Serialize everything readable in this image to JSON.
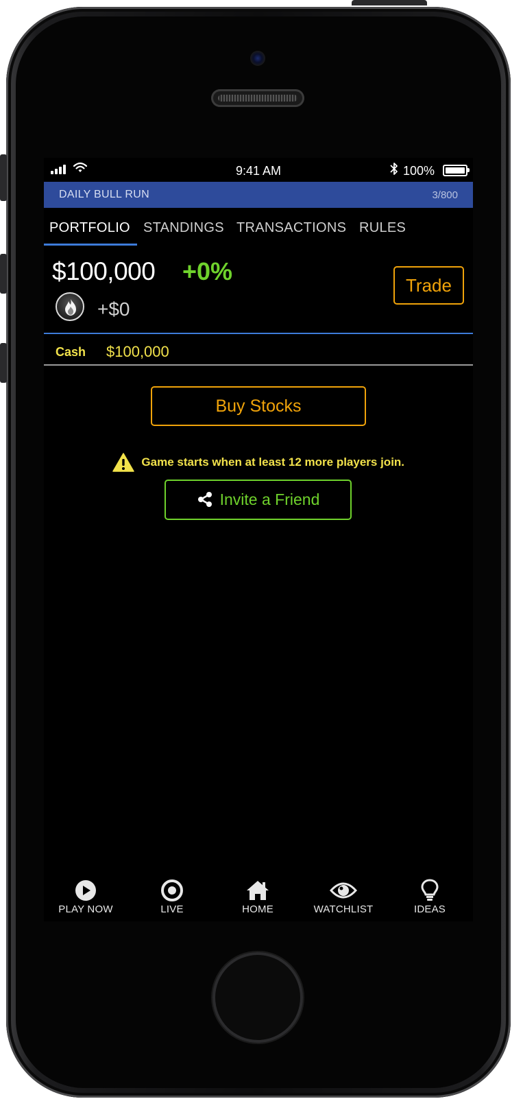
{
  "status_bar": {
    "time": "9:41 AM",
    "battery": "100%",
    "icons": [
      "signal-icon",
      "wifi-icon",
      "bluetooth-icon",
      "battery-icon"
    ]
  },
  "game": {
    "title": "DAILY BULL RUN",
    "count": "3/800"
  },
  "tabs": [
    {
      "label": "PORTFOLIO",
      "active": true
    },
    {
      "label": "STANDINGS",
      "active": false
    },
    {
      "label": "TRANSACTIONS",
      "active": false
    },
    {
      "label": "RULES",
      "active": false
    }
  ],
  "portfolio": {
    "balance": "$100,000",
    "change_pct": "+0%",
    "gain": "+$0",
    "badge_icon": "fire-icon",
    "trade_label": "Trade",
    "cash_label": "Cash",
    "cash_value": "$100,000"
  },
  "actions": {
    "buy_label": "Buy Stocks",
    "warning": "Game starts when at least 12 more players join.",
    "invite_label": "Invite a Friend"
  },
  "bottom_nav": [
    {
      "label": "PLAY NOW",
      "icon": "play-icon"
    },
    {
      "label": "LIVE",
      "icon": "live-icon"
    },
    {
      "label": "HOME",
      "icon": "home-icon"
    },
    {
      "label": "WATCHLIST",
      "icon": "eye-icon"
    },
    {
      "label": "IDEAS",
      "icon": "lightbulb-icon"
    }
  ],
  "colors": {
    "accent_orange": "#f0a30a",
    "accent_green": "#6fd22c",
    "accent_yellow": "#f2e24b",
    "header_blue": "#2e4b9b",
    "tab_underline": "#3d7bd9"
  }
}
